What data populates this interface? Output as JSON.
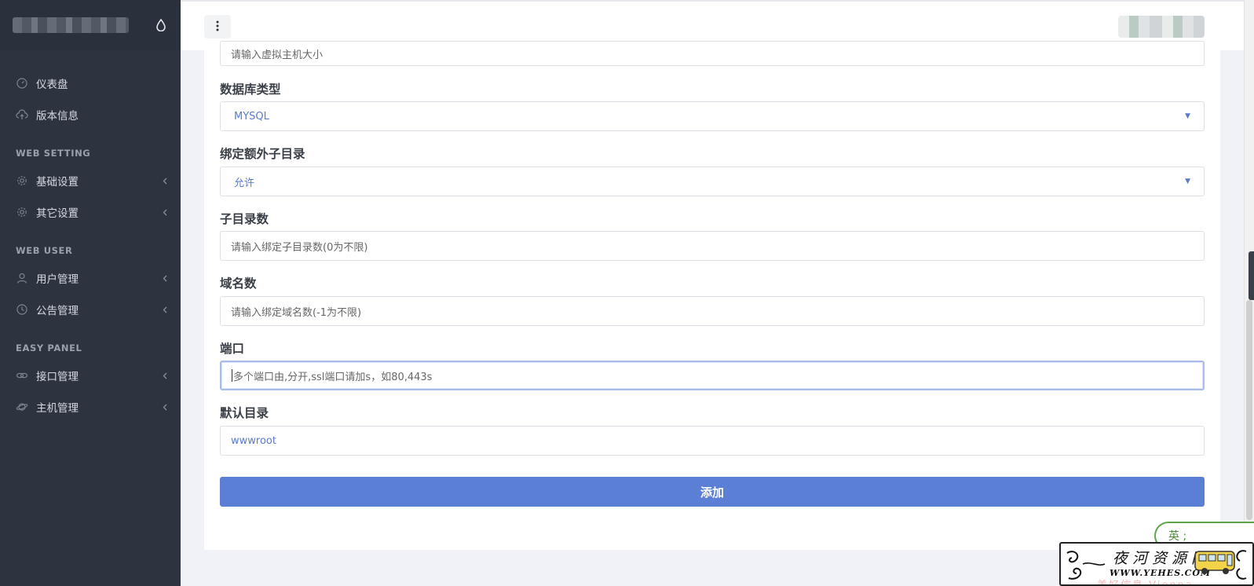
{
  "sidebar": {
    "items_top": [
      {
        "label": "仪表盘",
        "icon": "gauge-icon"
      },
      {
        "label": "版本信息",
        "icon": "cloud-icon"
      }
    ],
    "sections": [
      {
        "title": "WEB SETTING",
        "items": [
          {
            "label": "基础设置",
            "icon": "gear-icon"
          },
          {
            "label": "其它设置",
            "icon": "gear-icon"
          }
        ]
      },
      {
        "title": "WEB USER",
        "items": [
          {
            "label": "用户管理",
            "icon": "user-icon"
          },
          {
            "label": "公告管理",
            "icon": "clock-icon"
          }
        ]
      },
      {
        "title": "EASY PANEL",
        "items": [
          {
            "label": "接口管理",
            "icon": "link-icon"
          },
          {
            "label": "主机管理",
            "icon": "planet-icon"
          }
        ]
      }
    ]
  },
  "form": {
    "host_size_placeholder": "请输入虚拟主机大小",
    "db_type_label": "数据库类型",
    "db_type_value": "MYSQL",
    "subdir_bind_label": "绑定额外子目录",
    "subdir_bind_value": "允许",
    "subdir_count_label": "子目录数",
    "subdir_count_placeholder": "请输入绑定子目录数(0为不限)",
    "domain_count_label": "域名数",
    "domain_count_placeholder": "请输入绑定域名数(-1为不限)",
    "port_label": "端口",
    "port_placeholder": "多个端口由,分开,ssl端口请加s，如80,443s",
    "default_dir_label": "默认目录",
    "default_dir_value": "wwwroot",
    "submit_label": "添加"
  },
  "chat_bubble_text": "英 ;",
  "watermark": {
    "title": "夜河资源网",
    "url": "WWW.YEHES.COM",
    "faded_text": "美好信息 Vienna"
  }
}
